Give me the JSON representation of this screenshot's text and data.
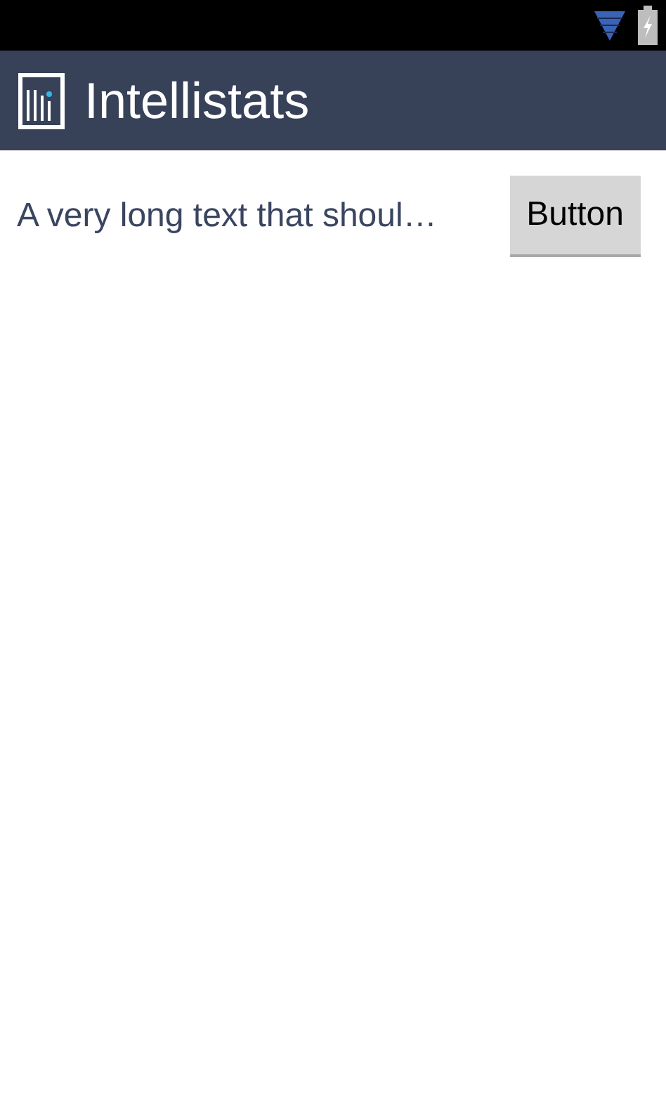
{
  "action_bar": {
    "title": "Intellistats"
  },
  "content": {
    "text": "A very long text that shoul…",
    "button": "Button"
  }
}
